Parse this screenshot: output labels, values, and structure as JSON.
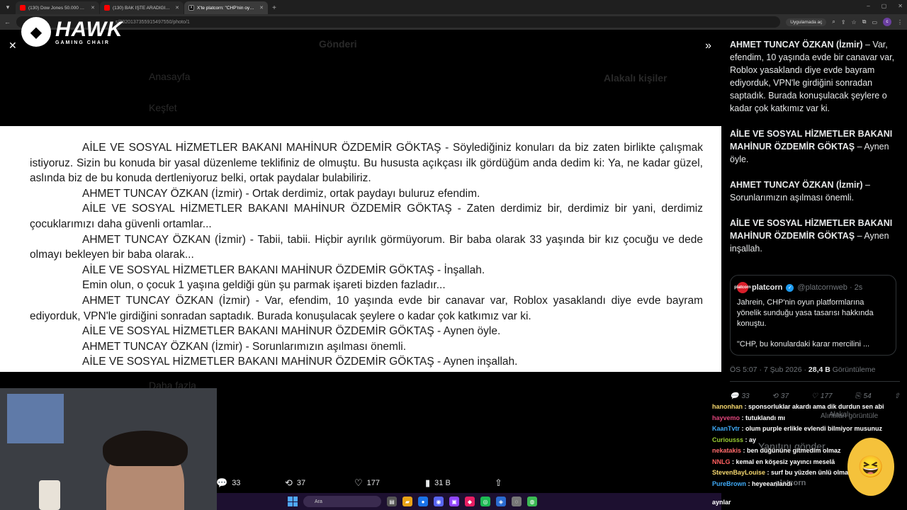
{
  "browser": {
    "tabs": [
      {
        "title": "(130) Dow Jones 50.000 Oldu !",
        "icon": "youtube-icon",
        "active": false
      },
      {
        "title": "(130) BAK İŞTE ARADIĞIM OYUN",
        "icon": "youtube-icon",
        "active": false
      },
      {
        "title": "X'te platcorn: \"CHP'nin oyunla",
        "icon": "x-icon",
        "active": true
      }
    ],
    "url": "s/2020137355915497550/photo/1",
    "open_in_app": "Uygulamada aç"
  },
  "logo": {
    "name": "HAWK",
    "sub": "GAMING CHAIR"
  },
  "viewer": {
    "ghost": {
      "back_title": "Gönderi",
      "home": "Anasayfa",
      "explore": "Keşfet",
      "related": "Alakalı kişiler",
      "more": "Daha fazla"
    },
    "document_lines": [
      {
        "text": "AİLE VE SOSYAL HİZMETLER BAKANI MAHİNUR ÖZDEMİR GÖKTAŞ - Söylediğiniz konuları da biz zaten birlikte çalışmak istiyoruz. Sizin bu konuda bir yasal düzenleme teklifiniz de olmuştu. Bu hususta açıkçası ilk gördüğüm anda dedim ki: Ya, ne kadar güzel, aslında biz de bu konuda dertleniyoruz belki, ortak paydalar bulabiliriz."
      },
      {
        "text": "AHMET TUNCAY ÖZKAN (İzmir) - Ortak derdimiz, ortak paydayı buluruz efendim."
      },
      {
        "text": "AİLE VE SOSYAL HİZMETLER BAKANI MAHİNUR ÖZDEMİR GÖKTAŞ - Zaten derdimiz bir, derdimiz bir yani, derdimiz çocuklarımızı daha güvenli ortamlar..."
      },
      {
        "text": "AHMET TUNCAY ÖZKAN (İzmir) - Tabii, tabii. Hiçbir ayrılık görmüyorum. Bir baba olarak 33 yaşında bir kız çocuğu ve dede olmayı bekleyen bir baba olarak..."
      },
      {
        "text": "AİLE VE SOSYAL HİZMETLER BAKANI MAHİNUR ÖZDEMİR GÖKTAŞ - İnşallah."
      },
      {
        "text": "Emin olun, o çocuk 1 yaşına geldiği gün şu parmak işareti bizden fazladır..."
      },
      {
        "text": "AHMET TUNCAY ÖZKAN (İzmir) - Var, efendim, 10 yaşında evde bir canavar var, Roblox yasaklandı diye evde bayram ediyorduk, VPN'le girdiğini sonradan saptadık. Burada konuşulacak şeylere o kadar çok katkımız var ki."
      },
      {
        "text": "AİLE VE SOSYAL HİZMETLER BAKANI MAHİNUR ÖZDEMİR GÖKTAŞ - Aynen öyle."
      },
      {
        "text": "AHMET TUNCAY ÖZKAN (İzmir) - Sorunlarımızın aşılması önemli."
      },
      {
        "text": "AİLE VE SOSYAL HİZMETLER BAKANI MAHİNUR ÖZDEMİR GÖKTAŞ - Aynen inşallah."
      }
    ],
    "actions": {
      "replies": "33",
      "reposts": "37",
      "likes": "177",
      "views": "31 B"
    }
  },
  "sidebar": {
    "reply_paragraphs": [
      {
        "speaker": "AHMET TUNCAY ÖZKAN (İzmir)",
        "text": " – Var, efendim, 10 yaşında evde bir canavar var, Roblox yasaklandı diye evde bayram ediyorduk, VPN'le girdiğini sonradan saptadık. Burada konuşulacak şeylere o kadar çok katkımız var ki."
      },
      {
        "speaker": "AİLE VE SOSYAL HİZMETLER BAKANI MAHİNUR ÖZDEMİR GÖKTAŞ",
        "text": " – Aynen öyle."
      },
      {
        "speaker": "AHMET TUNCAY ÖZKAN (İzmir)",
        "text": " – Sorunlarımızın aşılması önemli."
      },
      {
        "speaker": "AİLE VE SOSYAL HİZMETLER BAKANI MAHİNUR ÖZDEMİR GÖKTAŞ",
        "text": " – Aynen inşallah."
      }
    ],
    "quote": {
      "avatar_text": "platcorn",
      "name": "platcorn",
      "handle": "@platcornweb · 2s",
      "body": "Jahrein, CHP'nin oyun platformlarına yönelik sunduğu yasa tasarısı hakkında konuştu.",
      "body2": "\"CHP, bu konulardaki karar mercilini ..."
    },
    "meta": {
      "time": "ÖS 5:07 · 7 Şub 2026 · ",
      "views_count": "28,4 B",
      "views_label": " Görüntüleme"
    },
    "actions": {
      "replies": "33",
      "reposts": "37",
      "likes": "177",
      "bookmarks": "54"
    },
    "ghost": {
      "related": "Alakalı",
      "quotes": "Alıntıları görüntüle",
      "reply_prompt": "Yanıtını gönder",
      "platcorn": "platcorn",
      "handle": "@platcornweb"
    }
  },
  "chat": [
    {
      "user": "hanonhan",
      "text": "sponsorluklar akardı ama dik durdun sen abi",
      "color": "#f5d76e"
    },
    {
      "user": "hayvemo",
      "text": "tutuklandı mı",
      "color": "#e0457b"
    },
    {
      "user": "KaanTvtr",
      "text": "olum purple erlikle evlendi bilmiyor musunuz",
      "color": "#3fa9f5"
    },
    {
      "user": "Curiousss",
      "text": "ay",
      "color": "#9acd32"
    },
    {
      "user": "nekatakis",
      "text": "ben düğününe gitmedim olmaz",
      "color": "#ff6b6b"
    },
    {
      "user": "NNLG",
      "text": "kemal en köşesiz yayıncı meselā",
      "color": "#ff5e5e"
    },
    {
      "user": "StevenBayLouise",
      "text": "surf bu yüzden ünlü olmak istemiyorum",
      "color": "#f5d76e"
    },
    {
      "user": "PureBrown",
      "text": "heyeeanlandı",
      "color": "#3fa9f5"
    }
  ],
  "taskbar": {
    "search": "Ara"
  },
  "bottom_text": "aynlar"
}
